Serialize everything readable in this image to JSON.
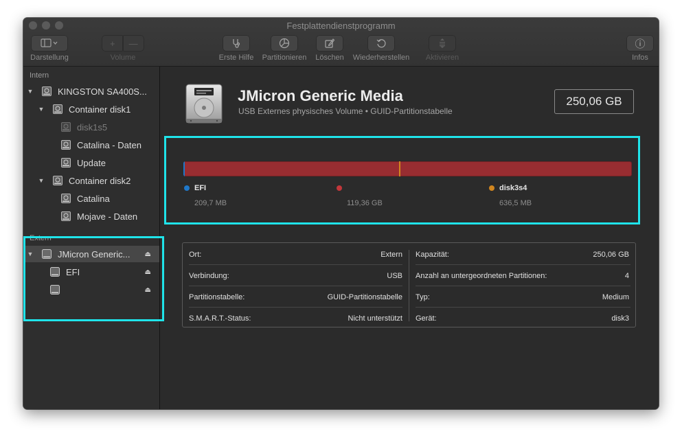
{
  "window": {
    "title": "Festplattendienstprogramm"
  },
  "toolbar": {
    "darstellung_label": "Darstellung",
    "volume_label": "Volume",
    "erste_hilfe_label": "Erste Hilfe",
    "partitionieren_label": "Partitionieren",
    "loeschen_label": "Löschen",
    "wiederherstellen_label": "Wiederherstellen",
    "aktivieren_label": "Aktivieren",
    "infos_label": "Infos",
    "volume_add_symbol": "+",
    "volume_remove_symbol": "—",
    "infos_symbol": "ⓘ"
  },
  "sidebar": {
    "intern_header": "Intern",
    "extern_header": "Extern",
    "intern_items": [
      {
        "label": "KINGSTON SA400S..."
      },
      {
        "label": "Container disk1"
      },
      {
        "label": "disk1s5"
      },
      {
        "label": "Catalina - Daten"
      },
      {
        "label": "Update"
      },
      {
        "label": "Container disk2"
      },
      {
        "label": "Catalina"
      },
      {
        "label": "Mojave - Daten"
      }
    ],
    "extern_items": [
      {
        "label": "JMicron Generic..."
      },
      {
        "label": "EFI"
      },
      {
        "label": ""
      }
    ]
  },
  "device": {
    "name": "JMicron Generic Media",
    "subtitle": "USB Externes physisches Volume • GUID-Partitionstabelle",
    "capacity": "250,06 GB"
  },
  "partitions": [
    {
      "name": "EFI",
      "size": "209,7 MB",
      "color": "#1f78c9",
      "fraction": 0.0008
    },
    {
      "name": "",
      "size": "119,36 GB",
      "color": "#c3373b",
      "fraction": 0.4773
    },
    {
      "name": "disk3s4",
      "size": "636,5 MB",
      "color": "#d1861f",
      "fraction": 0.0025
    }
  ],
  "info": {
    "left": [
      {
        "key": "Ort:",
        "value": "Extern"
      },
      {
        "key": "Verbindung:",
        "value": "USB"
      },
      {
        "key": "Partitionstabelle:",
        "value": "GUID-Partitionstabelle"
      },
      {
        "key": "S.M.A.R.T.-Status:",
        "value": "Nicht unterstützt"
      }
    ],
    "right": [
      {
        "key": "Kapazität:",
        "value": "250,06 GB"
      },
      {
        "key": "Anzahl an untergeordneten Partitionen:",
        "value": "4"
      },
      {
        "key": "Typ:",
        "value": "Medium"
      },
      {
        "key": "Gerät:",
        "value": "disk3"
      }
    ]
  },
  "colors": {
    "highlight": "#1fe4ea",
    "usage_bar": "#982d31"
  }
}
